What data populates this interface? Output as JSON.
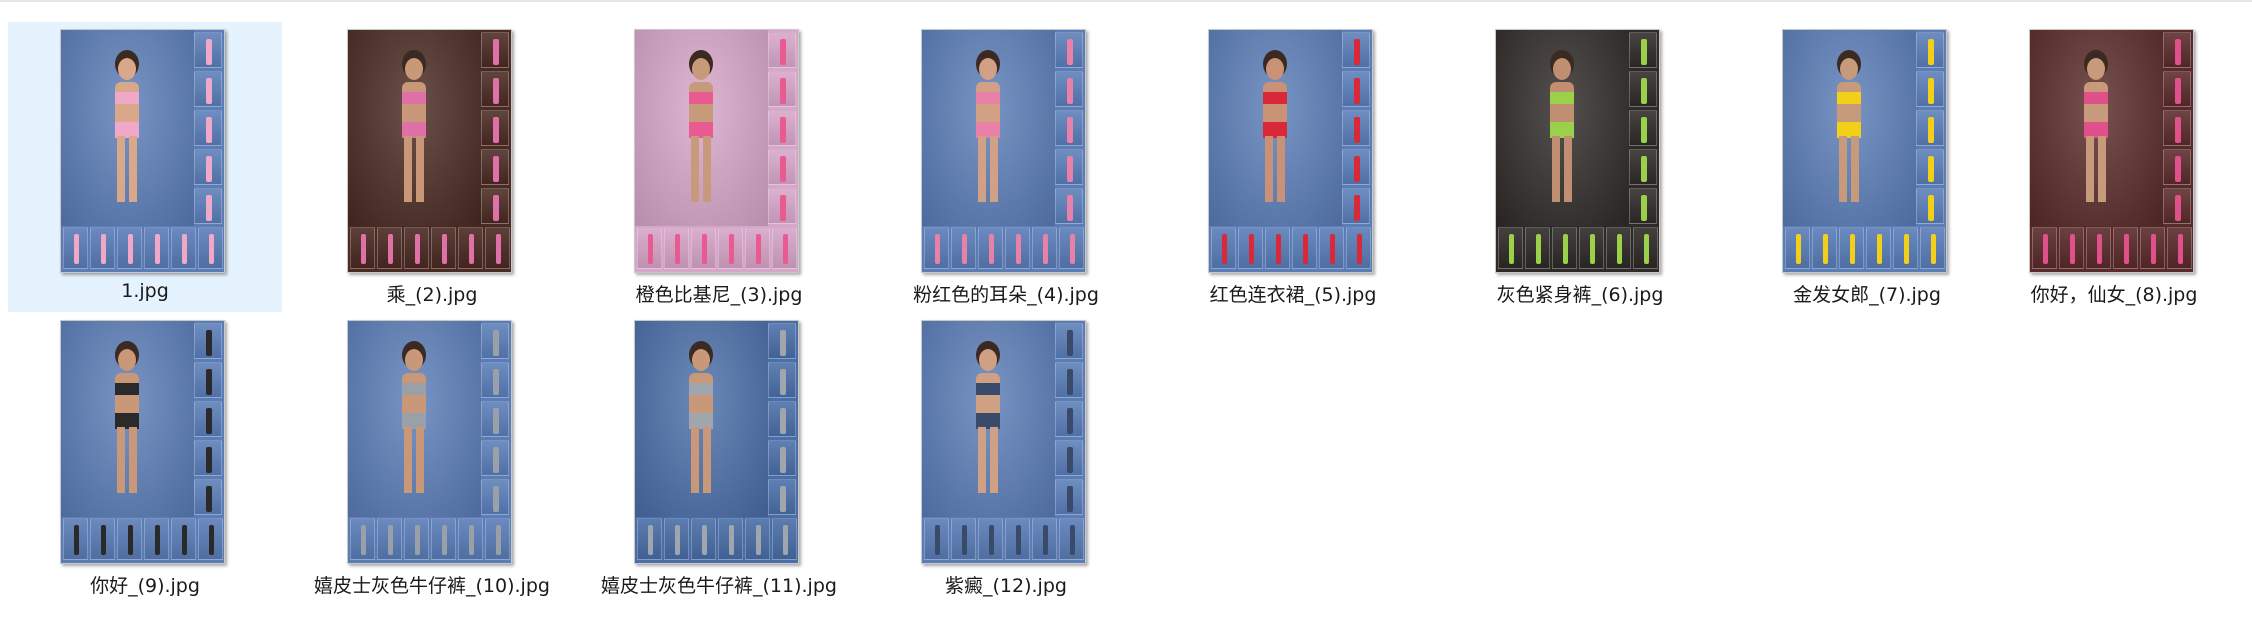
{
  "explorer": {
    "files": [
      {
        "name": "1.jpg",
        "selected": true,
        "bg": "#5a7db8",
        "accent": "#f0a8c8",
        "figure": "#d9a88a"
      },
      {
        "name": "乘_(2).jpg",
        "selected": false,
        "bg": "#4a2a22",
        "accent": "#e070a8",
        "figure": "#c99878"
      },
      {
        "name": "橙色比基尼_(3).jpg",
        "selected": false,
        "bg": "#d7a6c9",
        "accent": "#e85a90",
        "figure": "#c89a7c"
      },
      {
        "name": "粉红色的耳朵_(4).jpg",
        "selected": false,
        "bg": "#5a7db8",
        "accent": "#e880a8",
        "figure": "#d2a084"
      },
      {
        "name": "红色连衣裙_(5).jpg",
        "selected": false,
        "bg": "#5a7db8",
        "accent": "#d8283a",
        "figure": "#c99276"
      },
      {
        "name": "灰色紧身裤_(6).jpg",
        "selected": false,
        "bg": "#2e2a28",
        "accent": "#9ad04a",
        "figure": "#c08e70"
      },
      {
        "name": "金发女郎_(7).jpg",
        "selected": false,
        "bg": "#5a7db8",
        "accent": "#f2d01a",
        "figure": "#c89a7c"
      },
      {
        "name": "你好，仙女_(8).jpg",
        "selected": false,
        "bg": "#5a2a2a",
        "accent": "#e0508a",
        "figure": "#c89a7c"
      },
      {
        "name": "你好_(9).jpg",
        "selected": false,
        "bg": "#5a7db8",
        "accent": "#2a2a2a",
        "figure": "#c99878"
      },
      {
        "name": "嬉皮士灰色牛仔裤_(10).jpg",
        "selected": false,
        "bg": "#5a7db8",
        "accent": "#9aa0a8",
        "figure": "#c99878"
      },
      {
        "name": "嬉皮士灰色牛仔裤_(11).jpg",
        "selected": false,
        "bg": "#4a6ea8",
        "accent": "#a0a6ae",
        "figure": "#c99878"
      },
      {
        "name": "紫癜_(12).jpg",
        "selected": false,
        "bg": "#5a7db8",
        "accent": "#3a4a6a",
        "figure": "#d0a084"
      }
    ]
  }
}
